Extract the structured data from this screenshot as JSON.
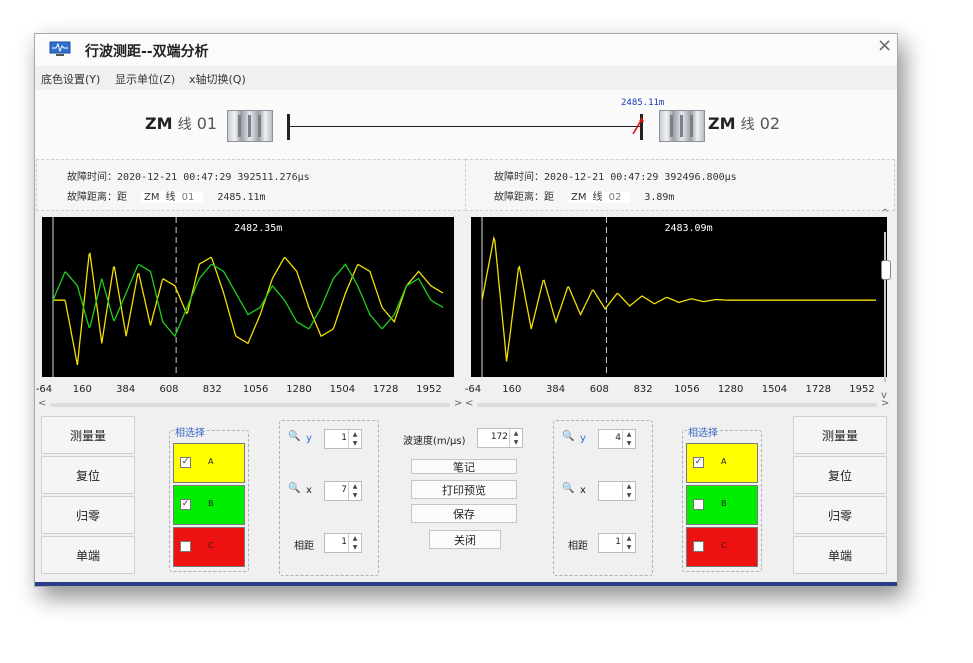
{
  "window": {
    "title": "行波测距--双端分析",
    "close": "×"
  },
  "menu": [
    "底色设置(Y)",
    "显示单位(Z)",
    "x轴切换(Q)"
  ],
  "topology": {
    "left_station": {
      "zm": "ZM",
      "xian": "线",
      "num": "01"
    },
    "right_station": {
      "zm": "ZM",
      "xian": "线",
      "num": "02"
    },
    "fault_distance_mark": "2485.11m"
  },
  "left_info": {
    "time_label": "故障时间：",
    "time_value": "2020-12-21 00:47:29 392511.276µs",
    "dist_label": "故障距离：距",
    "dist_station_zm": "ZM",
    "dist_station_xian": "线",
    "dist_station_num": "01",
    "dist_value": "2485.11m"
  },
  "right_info": {
    "time_label": "故障时间：",
    "time_value": "2020-12-21 00:47:29 392496.800µs",
    "dist_label": "故障距离：距",
    "dist_station_zm": "ZM",
    "dist_station_xian": "线",
    "dist_station_num": "02",
    "dist_value": "3.89m"
  },
  "chart_data": [
    {
      "type": "line",
      "title": "",
      "cursor_label": "2482.35m",
      "x_ticks": [
        "-64",
        "160",
        "384",
        "608",
        "832",
        "1056",
        "1280",
        "1504",
        "1728",
        "1952"
      ],
      "xlim": [
        -64,
        2000
      ],
      "series": [
        {
          "color": "#f2e000",
          "values": [
            0,
            0,
            -0.9,
            0.7,
            -0.6,
            0.5,
            -0.5,
            0.4,
            -0.35,
            0.3,
            0.2,
            -0.2,
            0.5,
            0.6,
            0.1,
            -0.5,
            -0.6,
            -0.2,
            0.3,
            0.6,
            0.4,
            -0.1,
            -0.5,
            -0.4,
            0.1,
            0.5,
            0.4,
            -0.1,
            -0.3,
            0.2,
            0.4,
            0.2,
            0.1
          ]
        },
        {
          "color": "#1fcf1f",
          "values": [
            0,
            0.4,
            0.2,
            -0.4,
            0.3,
            -0.3,
            0.1,
            0.5,
            0.4,
            -0.3,
            -0.5,
            -0.1,
            0.3,
            0.5,
            0.4,
            0.1,
            -0.2,
            -0.1,
            0.2,
            0.0,
            -0.3,
            -0.4,
            -0.1,
            0.3,
            0.5,
            0.2,
            -0.2,
            -0.4,
            -0.2,
            0.2,
            0.3,
            0.0,
            -0.1
          ]
        }
      ],
      "grid": false
    },
    {
      "type": "line",
      "title": "",
      "cursor_label": "2483.09m",
      "x_ticks": [
        "-64",
        "160",
        "384",
        "608",
        "832",
        "1056",
        "1280",
        "1504",
        "1728",
        "1952"
      ],
      "xlim": [
        -64,
        2000
      ],
      "series": [
        {
          "color": "#f2e000",
          "values": [
            0,
            0.9,
            -0.85,
            0.5,
            -0.4,
            0.3,
            -0.3,
            0.2,
            -0.2,
            0.15,
            -0.12,
            0.1,
            -0.08,
            0.06,
            -0.05,
            0.04,
            -0.03,
            0.02,
            -0.02,
            0.01,
            0,
            0,
            0,
            0,
            0,
            0,
            0,
            0,
            0,
            0,
            0,
            0,
            0
          ]
        }
      ],
      "grid": false
    }
  ],
  "left_controls": {
    "buttons": [
      "测量量",
      "复位",
      "归零",
      "单端"
    ],
    "phase_group_title": "相选择",
    "phases": [
      {
        "letter": "A",
        "checked": true,
        "color": "#ffff00"
      },
      {
        "letter": "B",
        "checked": true,
        "color": "#00ee00"
      },
      {
        "letter": "C",
        "checked": false,
        "color": "#ee1111"
      }
    ],
    "y_label": "y",
    "y_value": "1",
    "x_label": "x",
    "x_value": "7",
    "gap_label": "相距",
    "gap_value": "1"
  },
  "middle": {
    "wave_speed_label": "波速度(m/µs)",
    "wave_speed_value": "172",
    "buttons": [
      "笔记",
      "打印预览",
      "保存",
      "关闭"
    ]
  },
  "right_controls": {
    "buttons": [
      "测量量",
      "复位",
      "归零",
      "单端"
    ],
    "phase_group_title": "相选择",
    "phases": [
      {
        "letter": "A",
        "checked": true,
        "color": "#ffff00"
      },
      {
        "letter": "B",
        "checked": false,
        "color": "#00ee00"
      },
      {
        "letter": "C",
        "checked": false,
        "color": "#ee1111"
      }
    ],
    "y_label": "y",
    "y_value": "4",
    "x_label": "x",
    "x_value": "",
    "gap_label": "相距",
    "gap_value": "1"
  }
}
